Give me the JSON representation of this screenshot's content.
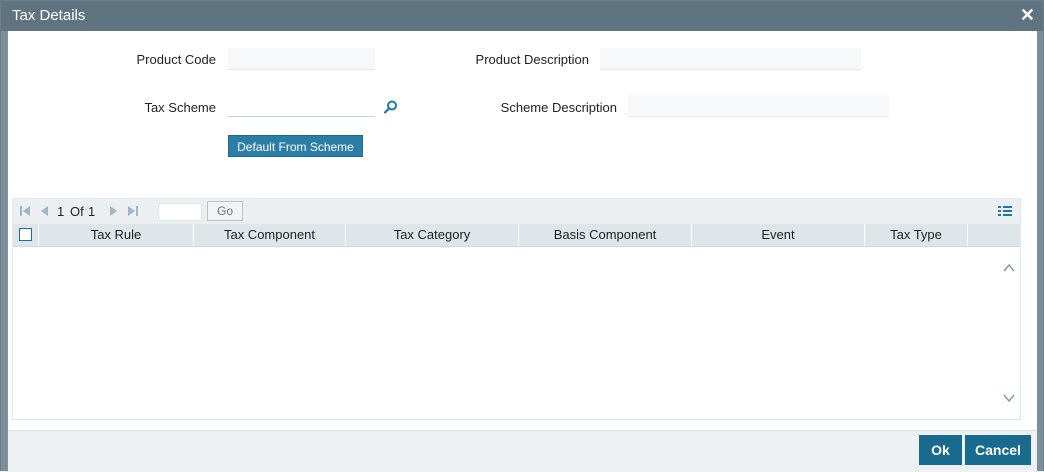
{
  "window": {
    "title": "Tax Details"
  },
  "form": {
    "product_code_label": "Product Code",
    "product_code_value": "",
    "product_description_label": "Product Description",
    "product_description_value": "",
    "tax_scheme_label": "Tax Scheme",
    "tax_scheme_value": "",
    "scheme_description_label": "Scheme Description",
    "scheme_description_value": "",
    "default_button_label": "Default From Scheme"
  },
  "grid": {
    "pager": {
      "current": "1",
      "of_label": "Of",
      "total": "1",
      "go_label": "Go"
    },
    "columns": [
      "Tax Rule",
      "Tax Component",
      "Tax Category",
      "Basis Component",
      "Event",
      "Tax Type"
    ],
    "rows": []
  },
  "footer": {
    "ok_label": "Ok",
    "cancel_label": "Cancel"
  },
  "colors": {
    "titlebar": "#5f7380",
    "primary_button": "#186b8e",
    "accent": "#2b7fa7"
  }
}
